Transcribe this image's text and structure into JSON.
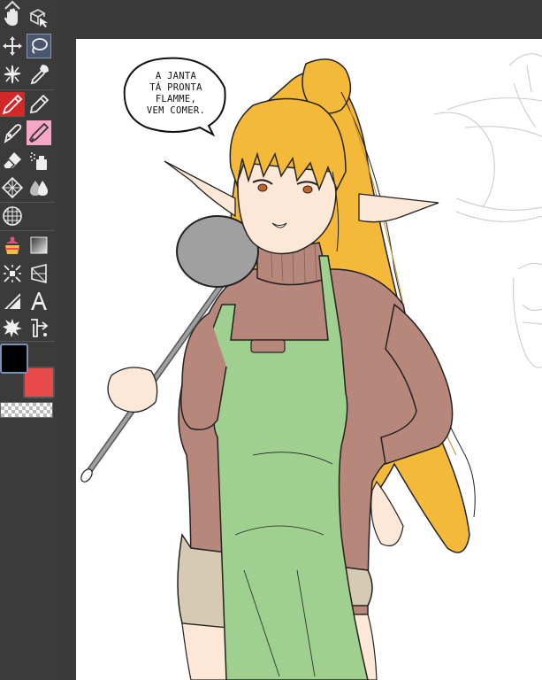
{
  "speech_bubble": {
    "lines": [
      "A JANTA",
      "TÁ PRONTA",
      "FLAMME,",
      "VEM COMER."
    ]
  },
  "toolbar": {
    "tools": [
      {
        "name": "hand-icon"
      },
      {
        "name": "object-select-icon"
      },
      {
        "name": "move-icon"
      },
      {
        "name": "lasso-select-icon",
        "active": true
      },
      {
        "name": "magic-wand-icon"
      },
      {
        "name": "eyedropper-icon"
      },
      {
        "name": "pen-icon",
        "active": true
      },
      {
        "name": "pencil-icon"
      },
      {
        "name": "brush-icon"
      },
      {
        "name": "marker-icon",
        "active": true
      },
      {
        "name": "eraser-icon"
      },
      {
        "name": "airbrush-icon"
      },
      {
        "name": "pattern-icon"
      },
      {
        "name": "blend-icon"
      },
      {
        "name": "grid-icon"
      },
      {
        "name": "fill-icon"
      },
      {
        "name": "gradient-icon"
      },
      {
        "name": "transform-icon"
      },
      {
        "name": "distort-icon"
      },
      {
        "name": "shape-icon"
      },
      {
        "name": "text-icon"
      },
      {
        "name": "splash-icon"
      },
      {
        "name": "ruler-icon"
      }
    ],
    "foreground_color": "#000000",
    "background_color": "#e84a4a"
  },
  "colors": {
    "canvas_bg": "#ffffff",
    "workspace_bg": "#3a3a3a",
    "toolbar_bg": "#3b3b3b",
    "hair": "#f5b93a",
    "sweater": "#b8877b",
    "apron": "#9fd08f",
    "shorts": "#d6cab2",
    "ladle": "#a0a0a0"
  }
}
